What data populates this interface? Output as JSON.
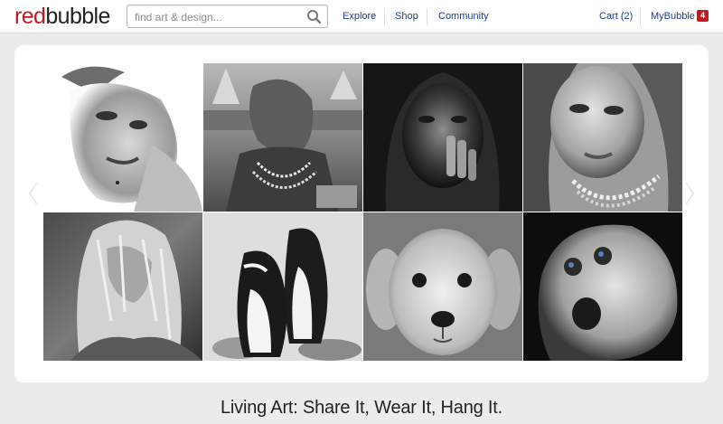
{
  "logo": {
    "part1": "red",
    "part2": "bubble"
  },
  "search": {
    "placeholder": "find art & design...",
    "value": "",
    "icon": "search-icon"
  },
  "nav": {
    "explore": "Explore",
    "shop": "Shop",
    "community": "Community",
    "cart": "Cart (2)",
    "mybubble": "MyBubble",
    "mybubble_badge": "4"
  },
  "gallery": {
    "tiles": [
      "portrait-woman-mohawk",
      "portrait-native-american-elder",
      "portrait-hooded-man-hand",
      "portrait-woman-necklace",
      "portrait-blonde-woman",
      "penguins",
      "puppy",
      "baby-surprised"
    ]
  },
  "tagline": "Living Art: Share It, Wear It, Hang It.",
  "colors": {
    "brand_red": "#c31a1f",
    "link_blue": "#1a3f8a",
    "page_bg": "#ececec"
  }
}
